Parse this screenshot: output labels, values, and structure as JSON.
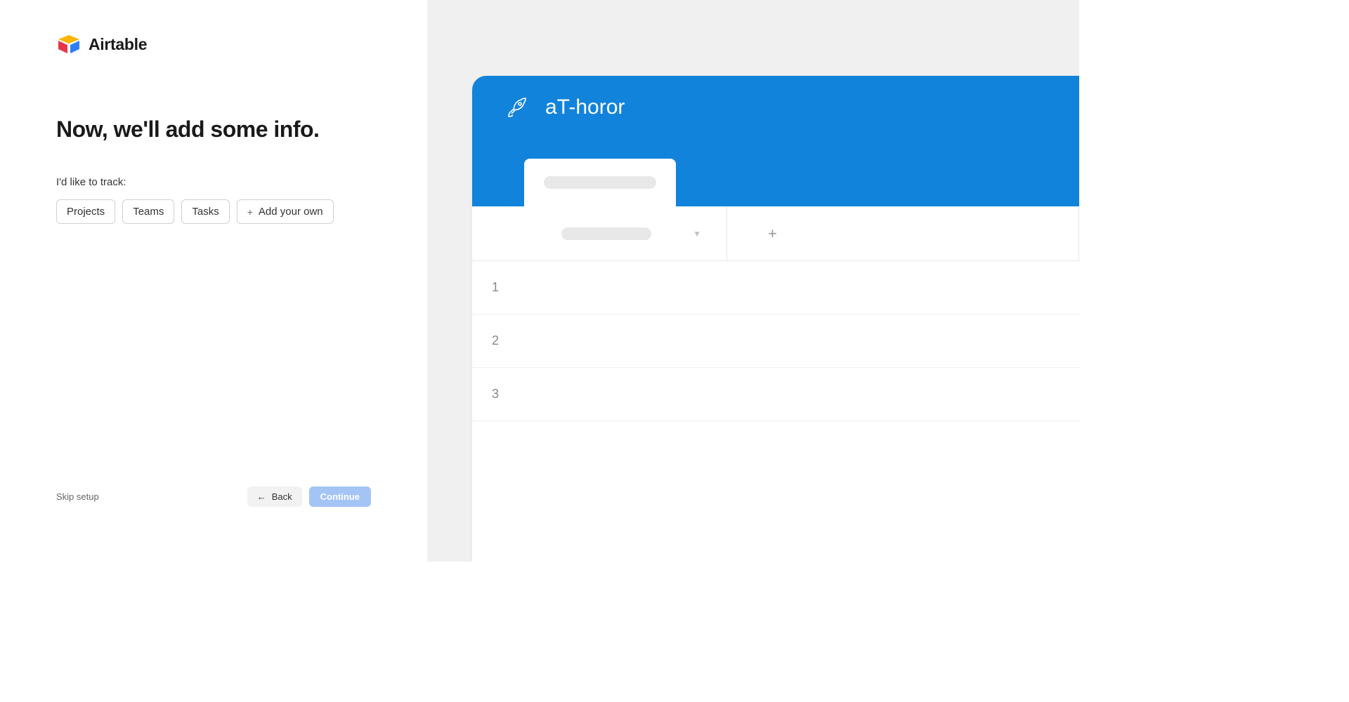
{
  "logo": {
    "text": "Airtable"
  },
  "heading": "Now, we'll add some info.",
  "subheading": "I'd like to track:",
  "options": [
    {
      "label": "Projects"
    },
    {
      "label": "Teams"
    },
    {
      "label": "Tasks"
    },
    {
      "label": "Add your own",
      "has_plus": true
    }
  ],
  "footer": {
    "skip": "Skip setup",
    "back": "Back",
    "continue": "Continue"
  },
  "preview": {
    "title": "aT-horor",
    "rows": [
      "1",
      "2",
      "3"
    ]
  }
}
